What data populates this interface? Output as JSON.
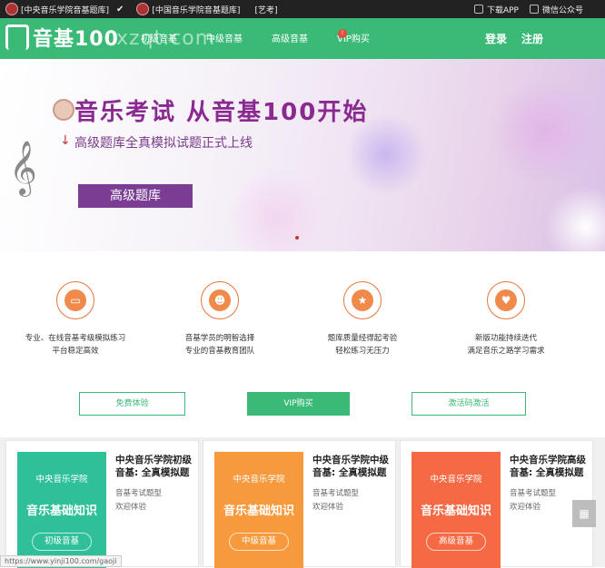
{
  "topbar": {
    "link1": "[中央音乐学院音基题库]",
    "link2": "[中国音乐学院音基题库]",
    "link3": "[艺考]",
    "download": "下载APP",
    "wechat": "微信公众号"
  },
  "header": {
    "logo_text": "音基100",
    "watermark": "xzqt.com",
    "nav": [
      "初级音基",
      "中级音基",
      "高级音基",
      "VIP购买"
    ],
    "login": "登录",
    "register": "注册"
  },
  "banner": {
    "title": "音乐考试  从音基100开始",
    "subtitle": "高级题库全真模拟试题正式上线",
    "button": "高级题库"
  },
  "features": [
    {
      "icon": "monitor-icon",
      "line1": "专业、在线音基考级模拟练习",
      "line2": "平台稳定高效"
    },
    {
      "icon": "team-icon",
      "line1": "音基学员的明智选择",
      "line2": "专业的音基教育团队"
    },
    {
      "icon": "star-icon",
      "line1": "题库质量经得起考验",
      "line2": "轻松练习无压力"
    },
    {
      "icon": "heart-icon",
      "line1": "新版功能持续迭代",
      "line2": "满足音乐之路学习需求"
    }
  ],
  "actions": {
    "trial": "免费体验",
    "vip": "VIP购买",
    "activate": "激活码激活"
  },
  "cards": [
    {
      "school": "中央音乐学院",
      "course": "音乐基础知识",
      "level": "初级音基",
      "title": "中央音乐学院初级音基: 全真模拟题",
      "tag1": "音基考试题型",
      "tag2": "欢迎体验",
      "color": "#2fc09a"
    },
    {
      "school": "中央音乐学院",
      "course": "音乐基础知识",
      "level": "中级音基",
      "title": "中央音乐学院中级音基: 全真模拟题",
      "tag1": "音基考试题型",
      "tag2": "欢迎体验",
      "color": "#f79a3e"
    },
    {
      "school": "中央音乐学院",
      "course": "音乐基础知识",
      "level": "高级音基",
      "title": "中央音乐学院高级音基: 全真模拟题",
      "tag1": "音基考试题型",
      "tag2": "欢迎体验",
      "color": "#f56a45"
    }
  ],
  "status_url": "https://www.yinji100.com/gaoji"
}
